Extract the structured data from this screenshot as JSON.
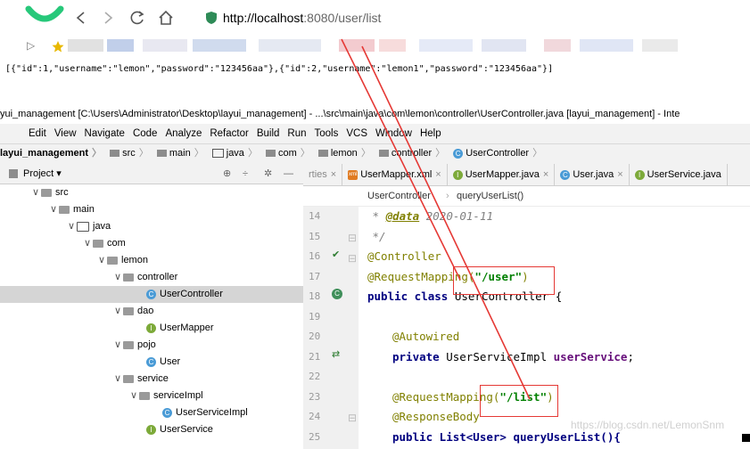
{
  "browser": {
    "url_host": "http://localhost",
    "url_rest": ":8080/user/list",
    "bookmark_arrow": "▷"
  },
  "json_output": "[{\"id\":1,\"username\":\"lemon\",\"password\":\"123456aa\"},{\"id\":2,\"username\":\"lemon1\",\"password\":\"123456aa\"}]",
  "ide": {
    "title": "yui_management [C:\\Users\\Administrator\\Desktop\\layui_management] - ...\\src\\main\\java\\com\\lemon\\controller\\UserController.java [layui_management] - Inte",
    "menu": [
      "Edit",
      "View",
      "Navigate",
      "Code",
      "Analyze",
      "Refactor",
      "Build",
      "Run",
      "Tools",
      "VCS",
      "Window",
      "Help"
    ],
    "breadcrumb": [
      "layui_management",
      "src",
      "main",
      "java",
      "com",
      "lemon",
      "controller",
      "UserController"
    ],
    "project_label": "Project ▾",
    "tree": [
      {
        "label": "src",
        "kind": "folder",
        "arrow": "∨"
      },
      {
        "label": "main",
        "kind": "folder",
        "arrow": "∨"
      },
      {
        "label": "java",
        "kind": "folder",
        "arrow": "∨"
      },
      {
        "label": "com",
        "kind": "folder",
        "arrow": "∨"
      },
      {
        "label": "lemon",
        "kind": "folder",
        "arrow": "∨"
      },
      {
        "label": "controller",
        "kind": "folder",
        "arrow": "∨"
      },
      {
        "label": "UserController",
        "kind": "class",
        "arrow": ""
      },
      {
        "label": "dao",
        "kind": "folder",
        "arrow": "∨"
      },
      {
        "label": "UserMapper",
        "kind": "interface",
        "arrow": ""
      },
      {
        "label": "pojo",
        "kind": "folder",
        "arrow": "∨"
      },
      {
        "label": "User",
        "kind": "class",
        "arrow": ""
      },
      {
        "label": "service",
        "kind": "folder",
        "arrow": "∨"
      },
      {
        "label": "serviceImpl",
        "kind": "folder",
        "arrow": "∨"
      },
      {
        "label": "UserServiceImpl",
        "kind": "class",
        "arrow": ""
      },
      {
        "label": "UserService",
        "kind": "interface",
        "arrow": ""
      }
    ],
    "tabs": [
      {
        "label": "rties",
        "icon": "",
        "close": "×"
      },
      {
        "label": "UserMapper.xml",
        "icon": "xml",
        "close": "×"
      },
      {
        "label": "UserMapper.java",
        "icon": "I",
        "close": "×"
      },
      {
        "label": "User.java",
        "icon": "C",
        "close": "×"
      },
      {
        "label": "UserService.java",
        "icon": "I",
        "close": ""
      }
    ],
    "editor_crumb": [
      "UserController",
      "queryUserList()"
    ],
    "line_numbers": [
      "14",
      "15",
      "16",
      "17",
      "18",
      "19",
      "20",
      "21",
      "22",
      "23",
      "24",
      "25"
    ],
    "code": {
      "l14_a": " * ",
      "l14_b": "@data",
      "l14_c": " 2020-01-11",
      "l15": " */",
      "l16": "@Controller",
      "l17_a": "@RequestMapping(",
      "l17_b": "\"/user\"",
      "l17_c": ")",
      "l18_a": "public class ",
      "l18_b": "UserController {",
      "l20": "@Autowired",
      "l21_a": "private ",
      "l21_b": "UserServiceImpl ",
      "l21_c": "userService",
      "l21_d": ";",
      "l23_a": "@RequestMapping(",
      "l23_b": "\"/list\"",
      "l23_c": ")",
      "l24": "@ResponseBody",
      "l25": "public List<User> queryUserList(){"
    },
    "watermark": "https://blog.csdn.net/LemonSnm"
  },
  "colors": {
    "annotation_box": "#e53935",
    "arrow": "#e53935"
  }
}
